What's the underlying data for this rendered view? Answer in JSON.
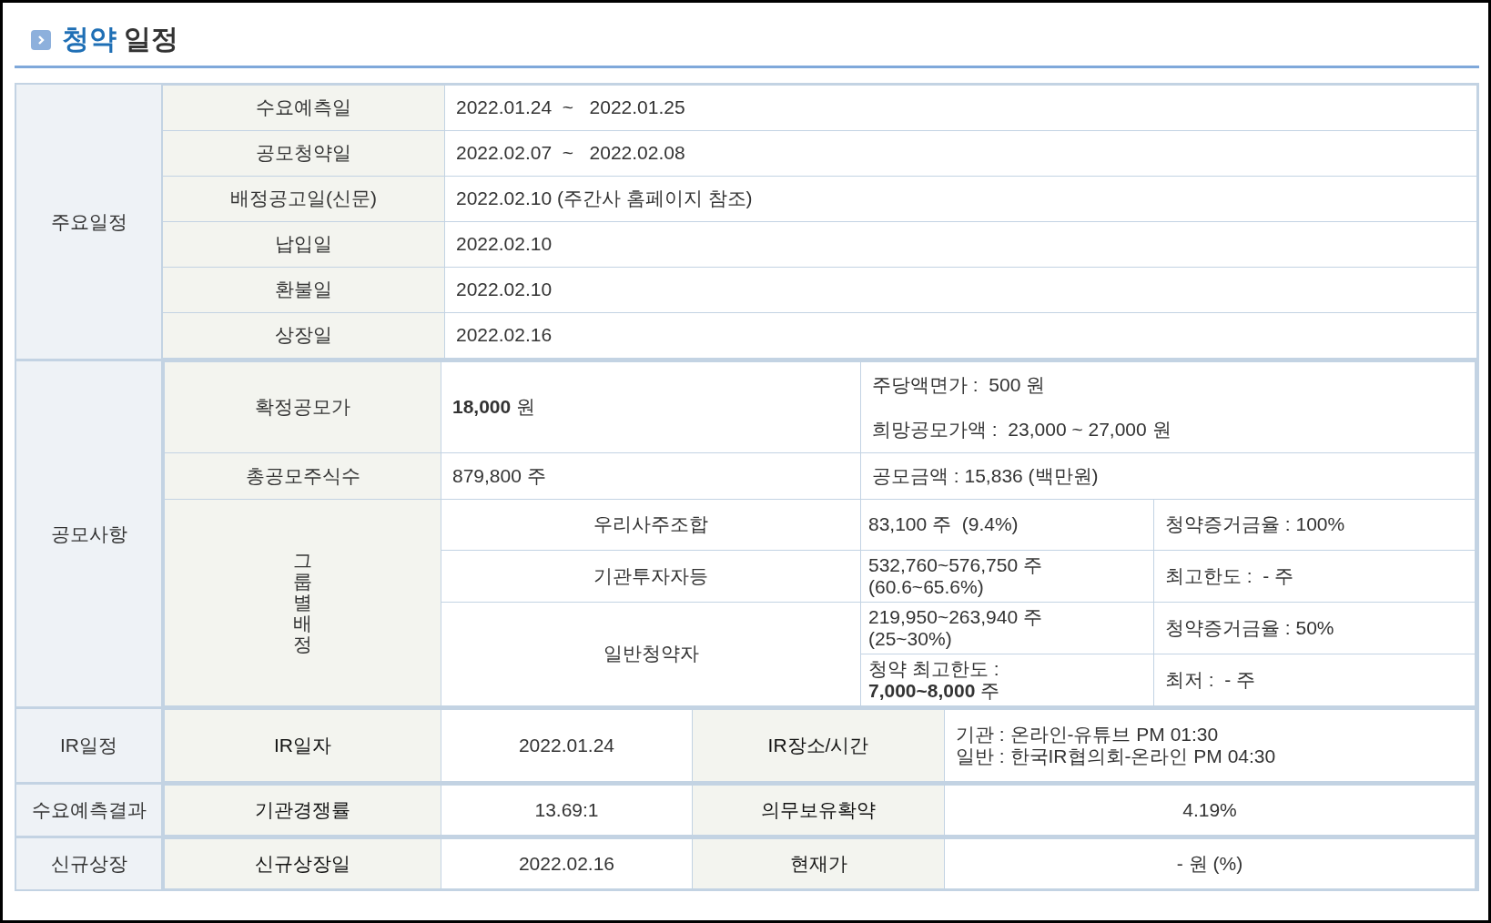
{
  "title": {
    "highlight": "청약",
    "rest": "일정"
  },
  "schedule": {
    "label": "주요일정",
    "rows": [
      {
        "key": "수요예측일",
        "value": "2022.01.24  ~   2022.01.25"
      },
      {
        "key": "공모청약일",
        "value": "2022.02.07  ~   2022.02.08"
      },
      {
        "key": "배정공고일(신문)",
        "value": "2022.02.10 (주간사 홈페이지 참조)"
      },
      {
        "key": "납입일",
        "value": "2022.02.10"
      },
      {
        "key": "환불일",
        "value": "2022.02.10"
      },
      {
        "key": "상장일",
        "value": "2022.02.16"
      }
    ]
  },
  "offering": {
    "label": "공모사항",
    "price": {
      "key": "확정공모가",
      "value": "**18,000** 원",
      "par": "주당액면가 :  500 원",
      "hope": "희망공모가액 :  23,000 ~ 27,000 원"
    },
    "shares": {
      "key": "총공모주식수",
      "value": "879,800 주",
      "amount": "공모금액 : 15,836 (백만원)"
    },
    "allocation": {
      "label": "그룹별배정",
      "groups": [
        {
          "name": "우리사주조합",
          "lines": [
            {
              "quantity": "83,100 주  (9.4%)",
              "note": "청약증거금율 : 100%"
            }
          ]
        },
        {
          "name": "기관투자자등",
          "lines": [
            {
              "quantity": "532,760~576,750 주 (60.6~65.6%)",
              "note": "최고한도 :  - 주"
            }
          ]
        },
        {
          "name": "일반청약자",
          "lines": [
            {
              "quantity": "219,950~263,940 주 (25~30%)",
              "note": "청약증거금율 : 50%"
            },
            {
              "quantity": "청약 최고한도 :  **7,000~8,000** 주",
              "note": "최저 :  - 주"
            }
          ]
        }
      ]
    }
  },
  "events": [
    {
      "label": "IR일정",
      "key1": "IR일자",
      "value1": "2022.01.24",
      "key2": "IR장소/시간",
      "value2": [
        "기관 : 온라인-유튜브 PM 01:30",
        "일반 : 한국IR협의회-온라인 PM 04:30"
      ]
    },
    {
      "label": "수요예측결과",
      "key1": "기관경쟁률",
      "value1": "13.69:1",
      "key2": "의무보유확약",
      "value2": [
        "4.19%"
      ]
    },
    {
      "label": "신규상장",
      "key1": "신규상장일",
      "value1": "2022.02.16",
      "key2": "현재가",
      "value2": [
        "- 원 (%)"
      ]
    }
  ]
}
